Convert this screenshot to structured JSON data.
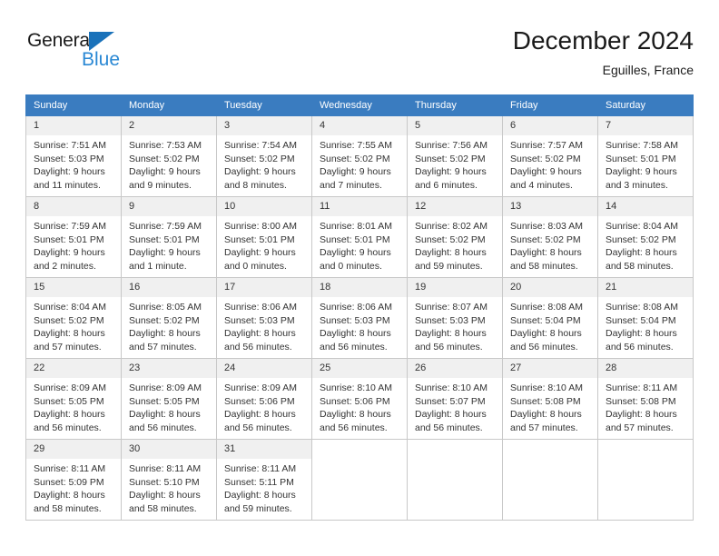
{
  "brand": {
    "name_part1": "General",
    "name_part2": "Blue",
    "triangle_color": "#1a72ba",
    "blue_text_color": "#2a88d4"
  },
  "header": {
    "month_title": "December 2024",
    "location": "Eguilles, France"
  },
  "theme": {
    "header_bg": "#3a7cc0",
    "header_text": "#ffffff",
    "daynum_bg": "#f0f0f0",
    "cell_border": "#c8c8c8",
    "body_text": "#333333"
  },
  "weekdays": [
    "Sunday",
    "Monday",
    "Tuesday",
    "Wednesday",
    "Thursday",
    "Friday",
    "Saturday"
  ],
  "calendar": {
    "month": "December",
    "year": 2024,
    "weeks": [
      [
        {
          "day": "1",
          "sunrise": "Sunrise: 7:51 AM",
          "sunset": "Sunset: 5:03 PM",
          "daylight1": "Daylight: 9 hours",
          "daylight2": "and 11 minutes."
        },
        {
          "day": "2",
          "sunrise": "Sunrise: 7:53 AM",
          "sunset": "Sunset: 5:02 PM",
          "daylight1": "Daylight: 9 hours",
          "daylight2": "and 9 minutes."
        },
        {
          "day": "3",
          "sunrise": "Sunrise: 7:54 AM",
          "sunset": "Sunset: 5:02 PM",
          "daylight1": "Daylight: 9 hours",
          "daylight2": "and 8 minutes."
        },
        {
          "day": "4",
          "sunrise": "Sunrise: 7:55 AM",
          "sunset": "Sunset: 5:02 PM",
          "daylight1": "Daylight: 9 hours",
          "daylight2": "and 7 minutes."
        },
        {
          "day": "5",
          "sunrise": "Sunrise: 7:56 AM",
          "sunset": "Sunset: 5:02 PM",
          "daylight1": "Daylight: 9 hours",
          "daylight2": "and 6 minutes."
        },
        {
          "day": "6",
          "sunrise": "Sunrise: 7:57 AM",
          "sunset": "Sunset: 5:02 PM",
          "daylight1": "Daylight: 9 hours",
          "daylight2": "and 4 minutes."
        },
        {
          "day": "7",
          "sunrise": "Sunrise: 7:58 AM",
          "sunset": "Sunset: 5:01 PM",
          "daylight1": "Daylight: 9 hours",
          "daylight2": "and 3 minutes."
        }
      ],
      [
        {
          "day": "8",
          "sunrise": "Sunrise: 7:59 AM",
          "sunset": "Sunset: 5:01 PM",
          "daylight1": "Daylight: 9 hours",
          "daylight2": "and 2 minutes."
        },
        {
          "day": "9",
          "sunrise": "Sunrise: 7:59 AM",
          "sunset": "Sunset: 5:01 PM",
          "daylight1": "Daylight: 9 hours",
          "daylight2": "and 1 minute."
        },
        {
          "day": "10",
          "sunrise": "Sunrise: 8:00 AM",
          "sunset": "Sunset: 5:01 PM",
          "daylight1": "Daylight: 9 hours",
          "daylight2": "and 0 minutes."
        },
        {
          "day": "11",
          "sunrise": "Sunrise: 8:01 AM",
          "sunset": "Sunset: 5:01 PM",
          "daylight1": "Daylight: 9 hours",
          "daylight2": "and 0 minutes."
        },
        {
          "day": "12",
          "sunrise": "Sunrise: 8:02 AM",
          "sunset": "Sunset: 5:02 PM",
          "daylight1": "Daylight: 8 hours",
          "daylight2": "and 59 minutes."
        },
        {
          "day": "13",
          "sunrise": "Sunrise: 8:03 AM",
          "sunset": "Sunset: 5:02 PM",
          "daylight1": "Daylight: 8 hours",
          "daylight2": "and 58 minutes."
        },
        {
          "day": "14",
          "sunrise": "Sunrise: 8:04 AM",
          "sunset": "Sunset: 5:02 PM",
          "daylight1": "Daylight: 8 hours",
          "daylight2": "and 58 minutes."
        }
      ],
      [
        {
          "day": "15",
          "sunrise": "Sunrise: 8:04 AM",
          "sunset": "Sunset: 5:02 PM",
          "daylight1": "Daylight: 8 hours",
          "daylight2": "and 57 minutes."
        },
        {
          "day": "16",
          "sunrise": "Sunrise: 8:05 AM",
          "sunset": "Sunset: 5:02 PM",
          "daylight1": "Daylight: 8 hours",
          "daylight2": "and 57 minutes."
        },
        {
          "day": "17",
          "sunrise": "Sunrise: 8:06 AM",
          "sunset": "Sunset: 5:03 PM",
          "daylight1": "Daylight: 8 hours",
          "daylight2": "and 56 minutes."
        },
        {
          "day": "18",
          "sunrise": "Sunrise: 8:06 AM",
          "sunset": "Sunset: 5:03 PM",
          "daylight1": "Daylight: 8 hours",
          "daylight2": "and 56 minutes."
        },
        {
          "day": "19",
          "sunrise": "Sunrise: 8:07 AM",
          "sunset": "Sunset: 5:03 PM",
          "daylight1": "Daylight: 8 hours",
          "daylight2": "and 56 minutes."
        },
        {
          "day": "20",
          "sunrise": "Sunrise: 8:08 AM",
          "sunset": "Sunset: 5:04 PM",
          "daylight1": "Daylight: 8 hours",
          "daylight2": "and 56 minutes."
        },
        {
          "day": "21",
          "sunrise": "Sunrise: 8:08 AM",
          "sunset": "Sunset: 5:04 PM",
          "daylight1": "Daylight: 8 hours",
          "daylight2": "and 56 minutes."
        }
      ],
      [
        {
          "day": "22",
          "sunrise": "Sunrise: 8:09 AM",
          "sunset": "Sunset: 5:05 PM",
          "daylight1": "Daylight: 8 hours",
          "daylight2": "and 56 minutes."
        },
        {
          "day": "23",
          "sunrise": "Sunrise: 8:09 AM",
          "sunset": "Sunset: 5:05 PM",
          "daylight1": "Daylight: 8 hours",
          "daylight2": "and 56 minutes."
        },
        {
          "day": "24",
          "sunrise": "Sunrise: 8:09 AM",
          "sunset": "Sunset: 5:06 PM",
          "daylight1": "Daylight: 8 hours",
          "daylight2": "and 56 minutes."
        },
        {
          "day": "25",
          "sunrise": "Sunrise: 8:10 AM",
          "sunset": "Sunset: 5:06 PM",
          "daylight1": "Daylight: 8 hours",
          "daylight2": "and 56 minutes."
        },
        {
          "day": "26",
          "sunrise": "Sunrise: 8:10 AM",
          "sunset": "Sunset: 5:07 PM",
          "daylight1": "Daylight: 8 hours",
          "daylight2": "and 56 minutes."
        },
        {
          "day": "27",
          "sunrise": "Sunrise: 8:10 AM",
          "sunset": "Sunset: 5:08 PM",
          "daylight1": "Daylight: 8 hours",
          "daylight2": "and 57 minutes."
        },
        {
          "day": "28",
          "sunrise": "Sunrise: 8:11 AM",
          "sunset": "Sunset: 5:08 PM",
          "daylight1": "Daylight: 8 hours",
          "daylight2": "and 57 minutes."
        }
      ],
      [
        {
          "day": "29",
          "sunrise": "Sunrise: 8:11 AM",
          "sunset": "Sunset: 5:09 PM",
          "daylight1": "Daylight: 8 hours",
          "daylight2": "and 58 minutes."
        },
        {
          "day": "30",
          "sunrise": "Sunrise: 8:11 AM",
          "sunset": "Sunset: 5:10 PM",
          "daylight1": "Daylight: 8 hours",
          "daylight2": "and 58 minutes."
        },
        {
          "day": "31",
          "sunrise": "Sunrise: 8:11 AM",
          "sunset": "Sunset: 5:11 PM",
          "daylight1": "Daylight: 8 hours",
          "daylight2": "and 59 minutes."
        },
        null,
        null,
        null,
        null
      ]
    ]
  }
}
